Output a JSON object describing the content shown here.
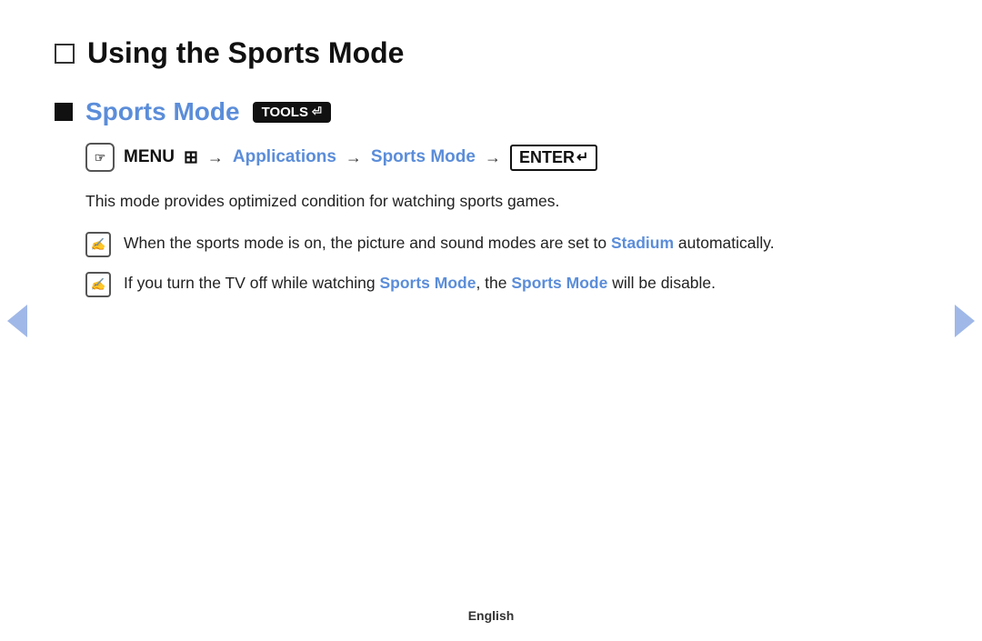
{
  "header": {
    "checkbox_label": "",
    "title": "Using the Sports Mode"
  },
  "section": {
    "title": "Sports Mode",
    "tools_badge": "TOOLS",
    "menu_icon": "m",
    "menu_label": "MENU",
    "menu_separator": "III",
    "arrow1": "→",
    "applications": "Applications",
    "arrow2": "→",
    "sports_mode": "Sports Mode",
    "arrow3": "→",
    "enter_label": "ENTER",
    "description": "This mode provides optimized condition for watching sports games.",
    "note1_prefix": "When the sports mode is on, the picture and sound modes are set to ",
    "note1_highlight": "Stadium",
    "note1_suffix": " automatically.",
    "note2_prefix": "If you turn the TV off while watching ",
    "note2_highlight1": "Sports Mode",
    "note2_middle": ", the ",
    "note2_highlight2": "Sports Mode",
    "note2_suffix": " will be disable."
  },
  "footer": {
    "language": "English"
  },
  "nav": {
    "left_label": "previous",
    "right_label": "next"
  },
  "colors": {
    "blue_link": "#5b8dd9",
    "nav_arrow": "#a0b8e8"
  }
}
